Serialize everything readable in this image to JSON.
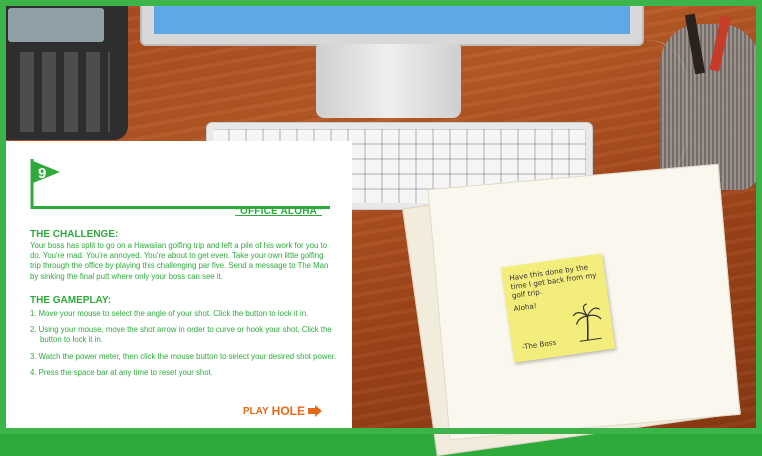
{
  "hole": {
    "number": "9",
    "title": "\"OFFICE ALOHA\""
  },
  "challenge": {
    "heading": "THE CHALLENGE:",
    "text": "Your boss has split to go on a Hawaiian golfing trip and left a pile of his work for you to do. You're mad. You're annoyed. You're about to get even. Take your own little golfing trip through the office by playing this challenging par five. Send a message to The Man by sinking the final putt where only your boss can see it."
  },
  "gameplay": {
    "heading": "THE GAMEPLAY:",
    "steps": [
      "1. Move your mouse to select the angle of your shot. Click the button to lock it in.",
      "2. Using your mouse, move the shot arrow in order to curve or hook your shot. Click the button to lock it in.",
      "3. Watch the power meter, then click the mouse button to select your desired shot power.",
      "4. Press the space bar at any time to reset your shot."
    ]
  },
  "play_button": {
    "play": "PLAY",
    "hole": "HOLE",
    "icon": "arrow-right-icon"
  },
  "sticky_note": {
    "message": "Have this done by the time I get back from my golf trip.",
    "aloha": "Aloha!",
    "signature": "-The Boss"
  },
  "colors": {
    "green": "#2eaa3c",
    "orange": "#e36b1c"
  }
}
